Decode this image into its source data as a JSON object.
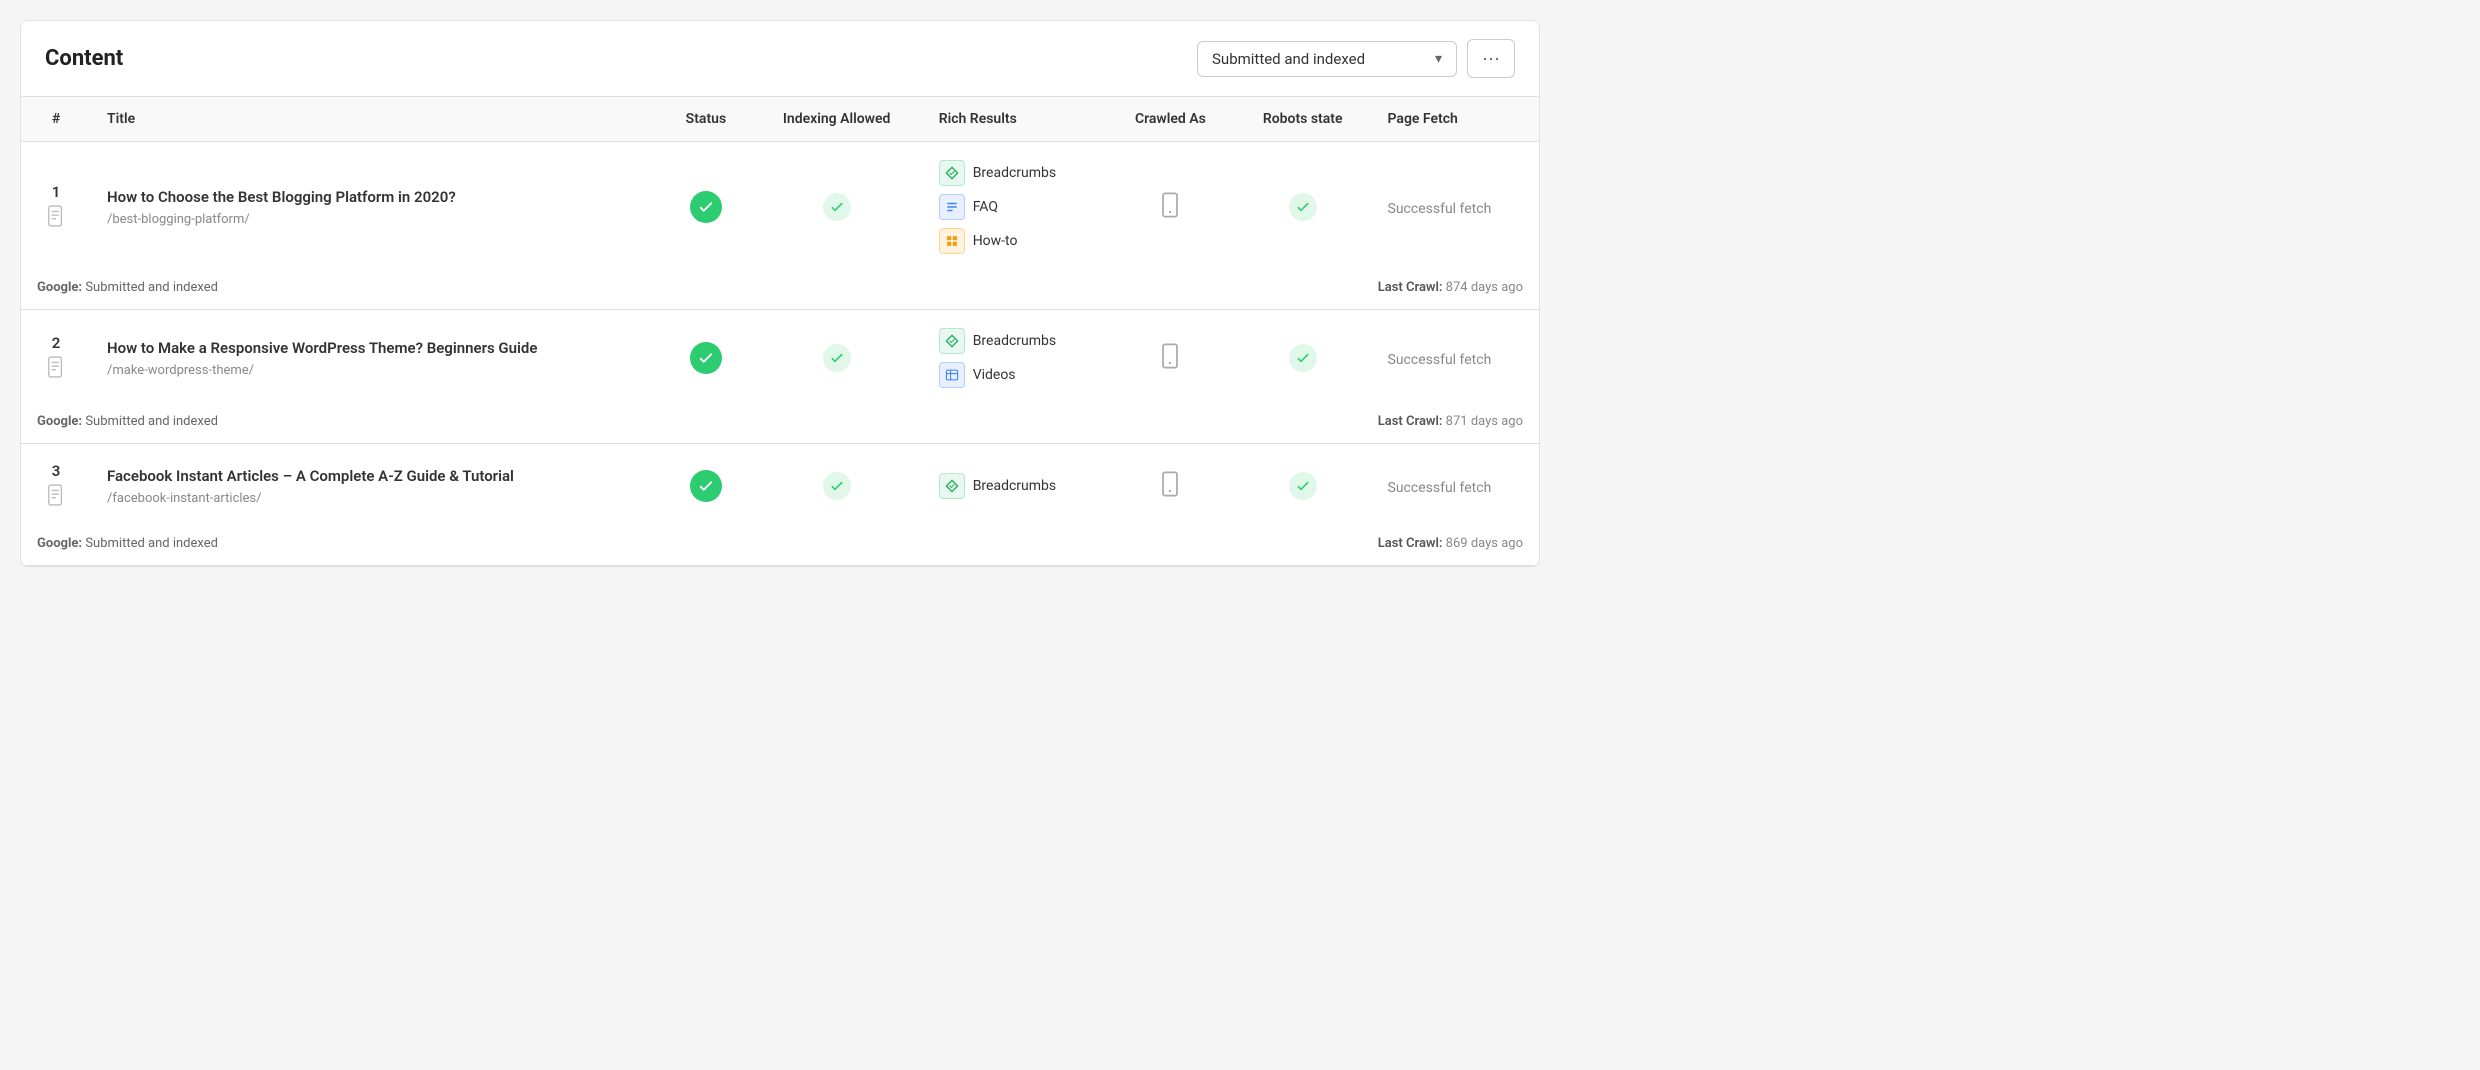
{
  "header": {
    "title": "Content",
    "dropdown_label": "Submitted and indexed",
    "more_button_label": "···"
  },
  "table": {
    "columns": [
      "#",
      "Title",
      "Status",
      "Indexing Allowed",
      "Rich Results",
      "Crawled As",
      "Robots state",
      "Page Fetch"
    ],
    "rows": [
      {
        "number": "1",
        "title": "How to Choose the Best Blogging Platform in 2020?",
        "url": "/best-blogging-platform/",
        "status": "check",
        "indexing_allowed": "check",
        "rich_results": [
          {
            "icon_type": "green",
            "icon_char": "◇",
            "label": "Breadcrumbs"
          },
          {
            "icon_type": "blue",
            "icon_char": "☰",
            "label": "FAQ"
          },
          {
            "icon_type": "orange",
            "icon_char": "⊞",
            "label": "How-to"
          }
        ],
        "crawled_as": "mobile",
        "robots_state": "check",
        "page_fetch": "Successful fetch",
        "google_status": "Submitted and indexed",
        "last_crawl": "874 days ago"
      },
      {
        "number": "2",
        "title": "How to Make a Responsive WordPress Theme? Beginners Guide",
        "url": "/make-wordpress-theme/",
        "status": "check",
        "indexing_allowed": "check",
        "rich_results": [
          {
            "icon_type": "green",
            "icon_char": "◇",
            "label": "Breadcrumbs"
          },
          {
            "icon_type": "blue",
            "icon_char": "▦",
            "label": "Videos"
          }
        ],
        "crawled_as": "mobile",
        "robots_state": "check",
        "page_fetch": "Successful fetch",
        "google_status": "Submitted and indexed",
        "last_crawl": "871 days ago"
      },
      {
        "number": "3",
        "title": "Facebook Instant Articles – A Complete A-Z Guide & Tutorial",
        "url": "/facebook-instant-articles/",
        "status": "check",
        "indexing_allowed": "check",
        "rich_results": [
          {
            "icon_type": "green",
            "icon_char": "◇",
            "label": "Breadcrumbs"
          }
        ],
        "crawled_as": "mobile",
        "robots_state": "check",
        "page_fetch": "Successful fetch",
        "google_status": "Submitted and indexed",
        "last_crawl": "869 days ago"
      }
    ]
  },
  "labels": {
    "google_prefix": "Google:",
    "last_crawl_prefix": "Last Crawl:"
  }
}
